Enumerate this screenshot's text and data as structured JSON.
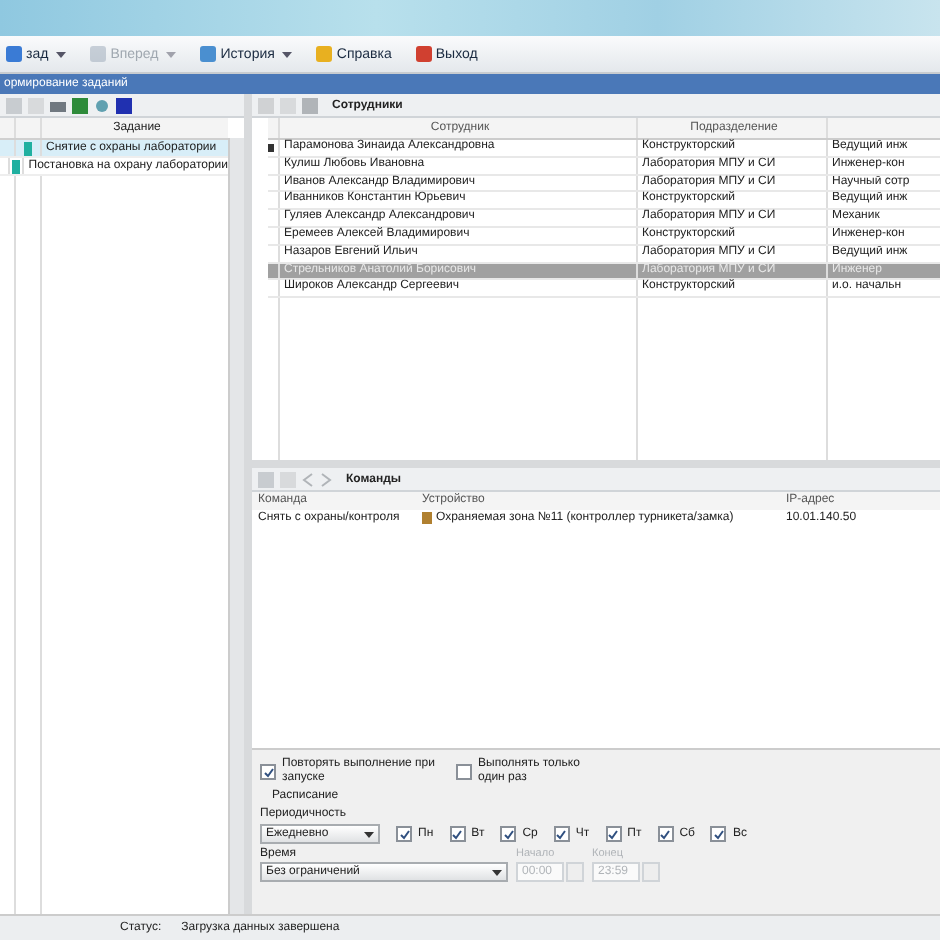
{
  "menu": [
    {
      "label": "зад",
      "caret": true,
      "disabled": false
    },
    {
      "label": "Вперед",
      "caret": true,
      "disabled": true
    },
    {
      "label": "История",
      "caret": true,
      "disabled": false
    },
    {
      "label": "Справка",
      "caret": false,
      "disabled": false
    },
    {
      "label": "Выход",
      "caret": false,
      "disabled": false
    }
  ],
  "header": "ормирование заданий",
  "tasks": {
    "column": "Задание",
    "rows": [
      {
        "name": "Снятие с охраны лаборатории",
        "selected": true
      },
      {
        "name": "Постановка на охрану лаборатории",
        "selected": false
      }
    ]
  },
  "employees": {
    "title": "Сотрудники",
    "columns": [
      "Сотрудник",
      "Подразделение"
    ],
    "rows": [
      {
        "name": "Парамонова Зинаида Александровна",
        "dept": "Конструкторский",
        "column_3": "Ведущий инж",
        "selected": false,
        "current": true
      },
      {
        "name": "Кулиш Любовь Ивановна",
        "dept": "Лаборатория МПУ и СИ",
        "column_3": "Инженер-кон",
        "selected": false,
        "current": false
      },
      {
        "name": "Иванов Александр Владимирович",
        "dept": "Лаборатория МПУ и СИ",
        "column_3": "Научный сотр",
        "selected": false,
        "current": false
      },
      {
        "name": "Иванников Константин Юрьевич",
        "dept": "Конструкторский",
        "column_3": "Ведущий инж",
        "selected": false,
        "current": false
      },
      {
        "name": "Гуляев Александр Александрович",
        "dept": "Лаборатория МПУ и СИ",
        "column_3": "Механик",
        "selected": false,
        "current": false
      },
      {
        "name": "Еремеев Алексей Владимирович",
        "dept": "Конструкторский",
        "column_3": "Инженер-кон",
        "selected": false,
        "current": false
      },
      {
        "name": "Назаров Евгений Ильич",
        "dept": "Лаборатория МПУ и СИ",
        "column_3": "Ведущий инж",
        "selected": false,
        "current": false
      },
      {
        "name": "Стрельников Анатолий Борисович",
        "dept": "Лаборатория МПУ и СИ",
        "column_3": "Инженер",
        "selected": true,
        "current": false
      },
      {
        "name": "Широков Александр Сергеевич",
        "dept": "Конструкторский",
        "column_3": "и.о. начальн",
        "selected": false,
        "current": false
      }
    ]
  },
  "commands": {
    "title": "Команды",
    "columns": [
      "Команда",
      "Устройство",
      "IP-адрес"
    ],
    "rows": [
      {
        "command": "Снять с охраны/контроля",
        "device": "Охраняемая зона №11 (контроллер турникета/замка)",
        "ip": "10.01.140.50"
      }
    ]
  },
  "options": {
    "repeat": {
      "label": "Повторять выполнение при запуске",
      "checked": true
    },
    "once": {
      "label": "Выполнять только один раз",
      "checked": false
    },
    "schedule_label": "Расписание",
    "period_label": "Периодичность",
    "period": "Ежедневно",
    "days": [
      {
        "label": "Пн",
        "checked": true
      },
      {
        "label": "Вт",
        "checked": true
      },
      {
        "label": "Ср",
        "checked": true
      },
      {
        "label": "Чт",
        "checked": true
      },
      {
        "label": "Пт",
        "checked": true
      },
      {
        "label": "Сб",
        "checked": true
      },
      {
        "label": "Вс",
        "checked": true
      }
    ],
    "time_label": "Время",
    "time": "Без ограничений",
    "start": {
      "label": "Начало",
      "value": "00:00",
      "disabled": true
    },
    "end": {
      "label": "Конец",
      "value": "23:59",
      "disabled": true
    }
  },
  "status": {
    "label": "Статус:",
    "text": "Загрузка данных завершена"
  }
}
